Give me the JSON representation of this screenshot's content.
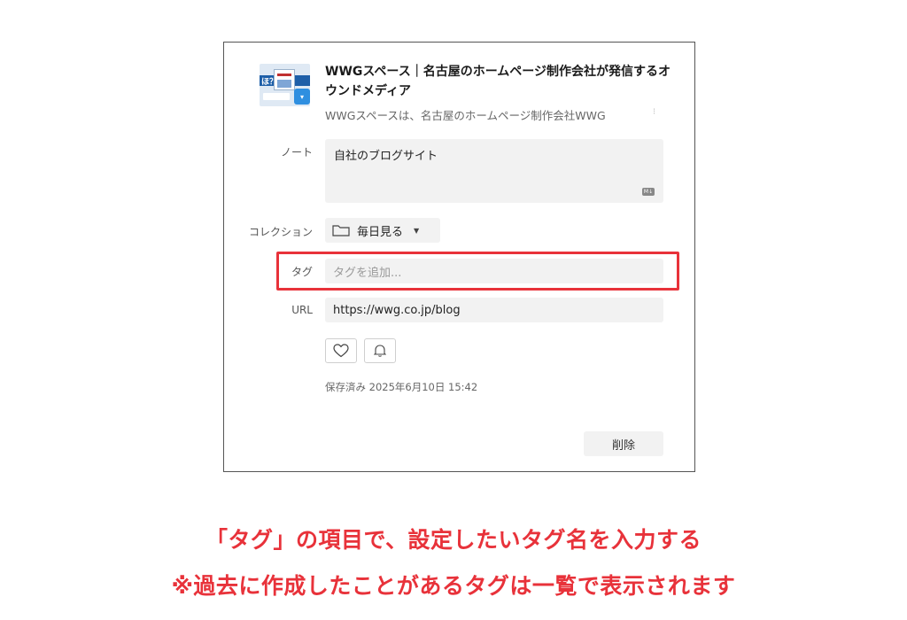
{
  "bookmark": {
    "title": "WWGスペース｜名古屋のホームページ制作会社が発信するオウンドメディア",
    "description": "WWGスペースは、名古屋のホームページ制作会社WWG",
    "thumbnail_text": "ほ？"
  },
  "note": {
    "label": "ノート",
    "value": "自社のブログサイト",
    "badge": "M↓"
  },
  "collection": {
    "label": "コレクション",
    "value": "毎日見る"
  },
  "tags": {
    "label": "タグ",
    "placeholder": "タグを追加..."
  },
  "url": {
    "label": "URL",
    "value": "https://wwg.co.jp/blog"
  },
  "saved": "保存済み 2025年6月10日 15:42",
  "delete_label": "削除",
  "caption": {
    "line1": "「タグ」の項目で、設定したいタグ名を入力する",
    "line2": "※過去に作成したことがあるタグは一覧で表示されます"
  },
  "colors": {
    "highlight": "#e8323a",
    "field_bg": "#f2f2f2"
  },
  "icons": [
    "folder-icon",
    "caret-down-icon",
    "heart-icon",
    "bell-icon",
    "markdown-icon"
  ]
}
